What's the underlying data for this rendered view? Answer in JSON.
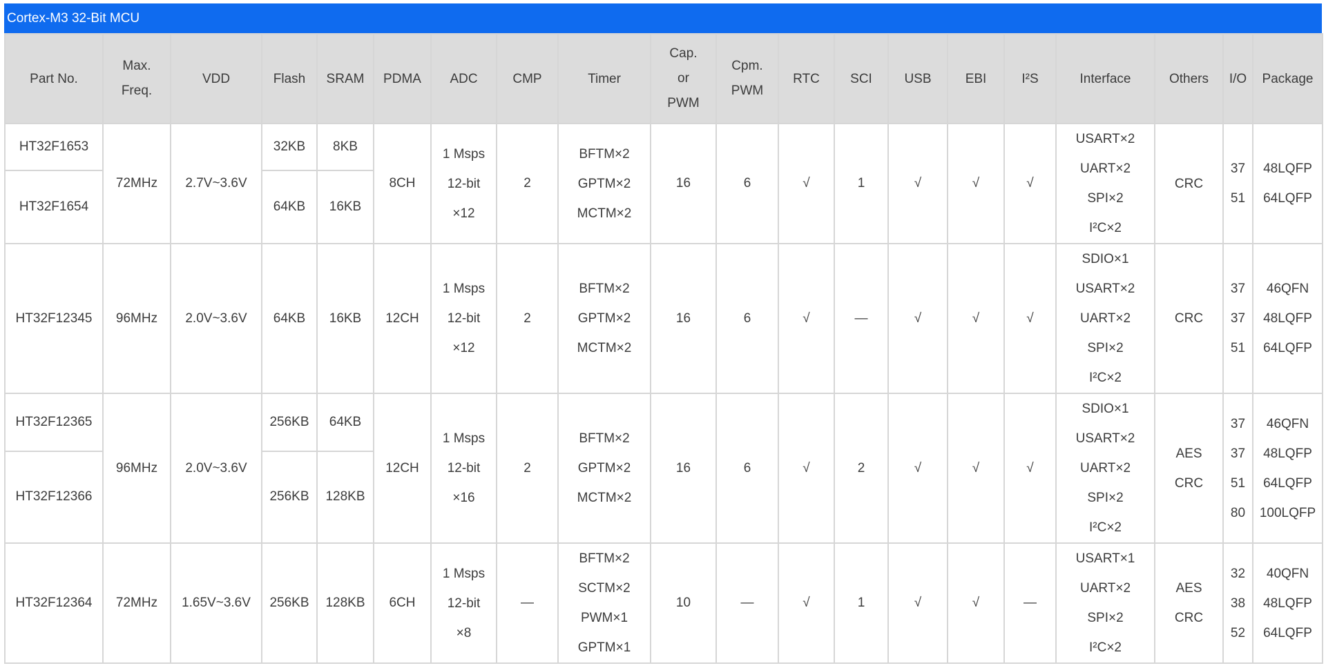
{
  "title": "Cortex-M3 32-Bit MCU",
  "columns": [
    [
      "Part No."
    ],
    [
      "Max.",
      "Freq."
    ],
    [
      "VDD"
    ],
    [
      "Flash"
    ],
    [
      "SRAM"
    ],
    [
      "PDMA"
    ],
    [
      "ADC"
    ],
    [
      "CMP"
    ],
    [
      "Timer"
    ],
    [
      "Cap.",
      "or",
      "PWM"
    ],
    [
      "Cpm.",
      "PWM"
    ],
    [
      "RTC"
    ],
    [
      "SCI"
    ],
    [
      "USB"
    ],
    [
      "EBI"
    ],
    [
      "I²S"
    ],
    [
      "Interface"
    ],
    [
      "Others"
    ],
    [
      "I/O"
    ],
    [
      "Package"
    ]
  ],
  "groups": [
    {
      "parts": [
        {
          "part": "HT32F1653",
          "flash": "32KB",
          "sram": "8KB"
        },
        {
          "part": "HT32F1654",
          "flash": "64KB",
          "sram": "16KB"
        }
      ],
      "freq": "72MHz",
      "vdd": "2.7V~3.6V",
      "pdma": "8CH",
      "adc": [
        "1 Msps",
        "12-bit",
        "×12"
      ],
      "cmp": "2",
      "timer": [
        "BFTM×2",
        "GPTM×2",
        "MCTM×2"
      ],
      "cap": "16",
      "cpm": "6",
      "rtc": "√",
      "sci": "1",
      "usb": "√",
      "ebi": "√",
      "i2s": "√",
      "interface": [
        "USART×2",
        "UART×2",
        "SPI×2",
        "I²C×2"
      ],
      "others": [
        "CRC"
      ],
      "io": [
        "37",
        "51"
      ],
      "package": [
        "48LQFP",
        "64LQFP"
      ]
    },
    {
      "parts": [
        {
          "part": "HT32F12345",
          "flash": "64KB",
          "sram": "16KB"
        }
      ],
      "freq": "96MHz",
      "vdd": "2.0V~3.6V",
      "pdma": "12CH",
      "adc": [
        "1 Msps",
        "12-bit",
        "×12"
      ],
      "cmp": "2",
      "timer": [
        "BFTM×2",
        "GPTM×2",
        "MCTM×2"
      ],
      "cap": "16",
      "cpm": "6",
      "rtc": "√",
      "sci": "—",
      "usb": "√",
      "ebi": "√",
      "i2s": "√",
      "interface": [
        "SDIO×1",
        "USART×2",
        "UART×2",
        "SPI×2",
        "I²C×2"
      ],
      "others": [
        "CRC"
      ],
      "io": [
        "37",
        "37",
        "51"
      ],
      "package": [
        "46QFN",
        "48LQFP",
        "64LQFP"
      ]
    },
    {
      "parts": [
        {
          "part": "HT32F12365",
          "flash": "256KB",
          "sram": "64KB"
        },
        {
          "part": "HT32F12366",
          "flash": "256KB",
          "sram": "128KB"
        }
      ],
      "freq": "96MHz",
      "vdd": "2.0V~3.6V",
      "pdma": "12CH",
      "adc": [
        "1 Msps",
        "12-bit",
        "×16"
      ],
      "cmp": "2",
      "timer": [
        "BFTM×2",
        "GPTM×2",
        "MCTM×2"
      ],
      "cap": "16",
      "cpm": "6",
      "rtc": "√",
      "sci": "2",
      "usb": "√",
      "ebi": "√",
      "i2s": "√",
      "interface": [
        "SDIO×1",
        "USART×2",
        "UART×2",
        "SPI×2",
        "I²C×2"
      ],
      "others": [
        "AES",
        "CRC"
      ],
      "io": [
        "37",
        "37",
        "51",
        "80"
      ],
      "package": [
        "46QFN",
        "48LQFP",
        "64LQFP",
        "100LQFP"
      ]
    },
    {
      "parts": [
        {
          "part": "HT32F12364",
          "flash": "256KB",
          "sram": "128KB"
        }
      ],
      "freq": "72MHz",
      "vdd": "1.65V~3.6V",
      "pdma": "6CH",
      "adc": [
        "1 Msps",
        "12-bit",
        "×8"
      ],
      "cmp": "—",
      "timer": [
        "BFTM×2",
        "SCTM×2",
        "PWM×1",
        "GPTM×1"
      ],
      "cap": "10",
      "cpm": "—",
      "rtc": "√",
      "sci": "1",
      "usb": "√",
      "ebi": "√",
      "i2s": "—",
      "interface": [
        "USART×1",
        "UART×2",
        "SPI×2",
        "I²C×2"
      ],
      "others": [
        "AES",
        "CRC"
      ],
      "io": [
        "32",
        "38",
        "52"
      ],
      "package": [
        "40QFN",
        "48LQFP",
        "64LQFP"
      ]
    }
  ]
}
